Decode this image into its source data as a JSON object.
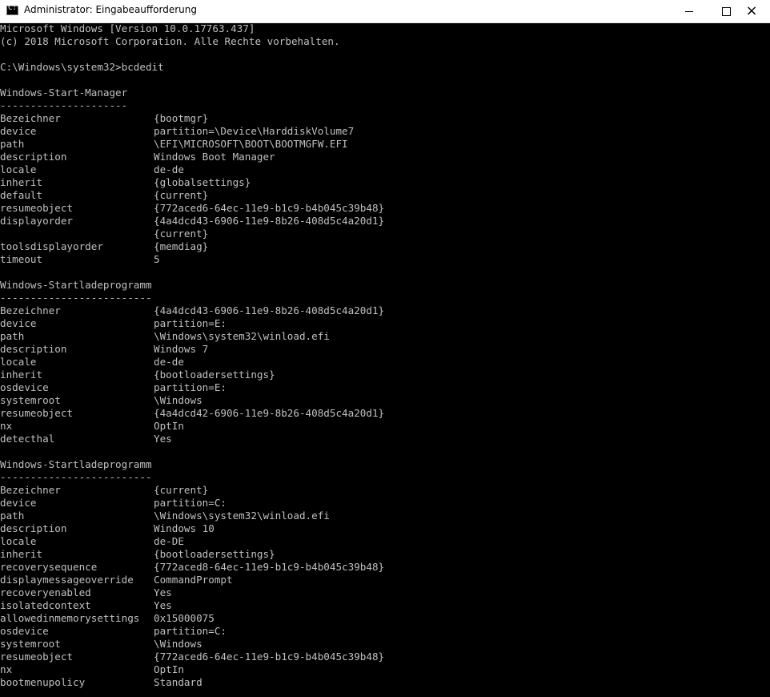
{
  "window": {
    "title": "Administrator: Eingabeaufforderung",
    "icon": "cmd-icon"
  },
  "console": {
    "lines": [
      "Microsoft Windows [Version 10.0.17763.437]",
      "(c) 2018 Microsoft Corporation. Alle Rechte vorbehalten.",
      "",
      "C:\\Windows\\system32>bcdedit",
      "",
      "Windows-Start-Manager",
      "---------------------",
      [
        "Bezeichner",
        "{bootmgr}"
      ],
      [
        "device",
        "partition=\\Device\\HarddiskVolume7"
      ],
      [
        "path",
        "\\EFI\\MICROSOFT\\BOOT\\BOOTMGFW.EFI"
      ],
      [
        "description",
        "Windows Boot Manager"
      ],
      [
        "locale",
        "de-de"
      ],
      [
        "inherit",
        "{globalsettings}"
      ],
      [
        "default",
        "{current}"
      ],
      [
        "resumeobject",
        "{772aced6-64ec-11e9-b1c9-b4b045c39b48}"
      ],
      [
        "displayorder",
        "{4a4dcd43-6906-11e9-8b26-408d5c4a20d1}"
      ],
      [
        "",
        "{current}"
      ],
      [
        "toolsdisplayorder",
        "{memdiag}"
      ],
      [
        "timeout",
        "5"
      ],
      "",
      "Windows-Startladeprogramm",
      "-------------------------",
      [
        "Bezeichner",
        "{4a4dcd43-6906-11e9-8b26-408d5c4a20d1}"
      ],
      [
        "device",
        "partition=E:"
      ],
      [
        "path",
        "\\Windows\\system32\\winload.efi"
      ],
      [
        "description",
        "Windows 7"
      ],
      [
        "locale",
        "de-de"
      ],
      [
        "inherit",
        "{bootloadersettings}"
      ],
      [
        "osdevice",
        "partition=E:"
      ],
      [
        "systemroot",
        "\\Windows"
      ],
      [
        "resumeobject",
        "{4a4dcd42-6906-11e9-8b26-408d5c4a20d1}"
      ],
      [
        "nx",
        "OptIn"
      ],
      [
        "detecthal",
        "Yes"
      ],
      "",
      "Windows-Startladeprogramm",
      "-------------------------",
      [
        "Bezeichner",
        "{current}"
      ],
      [
        "device",
        "partition=C:"
      ],
      [
        "path",
        "\\Windows\\system32\\winload.efi"
      ],
      [
        "description",
        "Windows 10"
      ],
      [
        "locale",
        "de-DE"
      ],
      [
        "inherit",
        "{bootloadersettings}"
      ],
      [
        "recoverysequence",
        "{772aced8-64ec-11e9-b1c9-b4b045c39b48}"
      ],
      [
        "displaymessageoverride",
        "CommandPrompt"
      ],
      [
        "recoveryenabled",
        "Yes"
      ],
      [
        "isolatedcontext",
        "Yes"
      ],
      [
        "allowedinmemorysettings",
        "0x15000075"
      ],
      [
        "osdevice",
        "partition=C:"
      ],
      [
        "systemroot",
        "\\Windows"
      ],
      [
        "resumeobject",
        "{772aced6-64ec-11e9-b1c9-b4b045c39b48}"
      ],
      [
        "nx",
        "OptIn"
      ],
      [
        "bootmenupolicy",
        "Standard"
      ]
    ]
  }
}
